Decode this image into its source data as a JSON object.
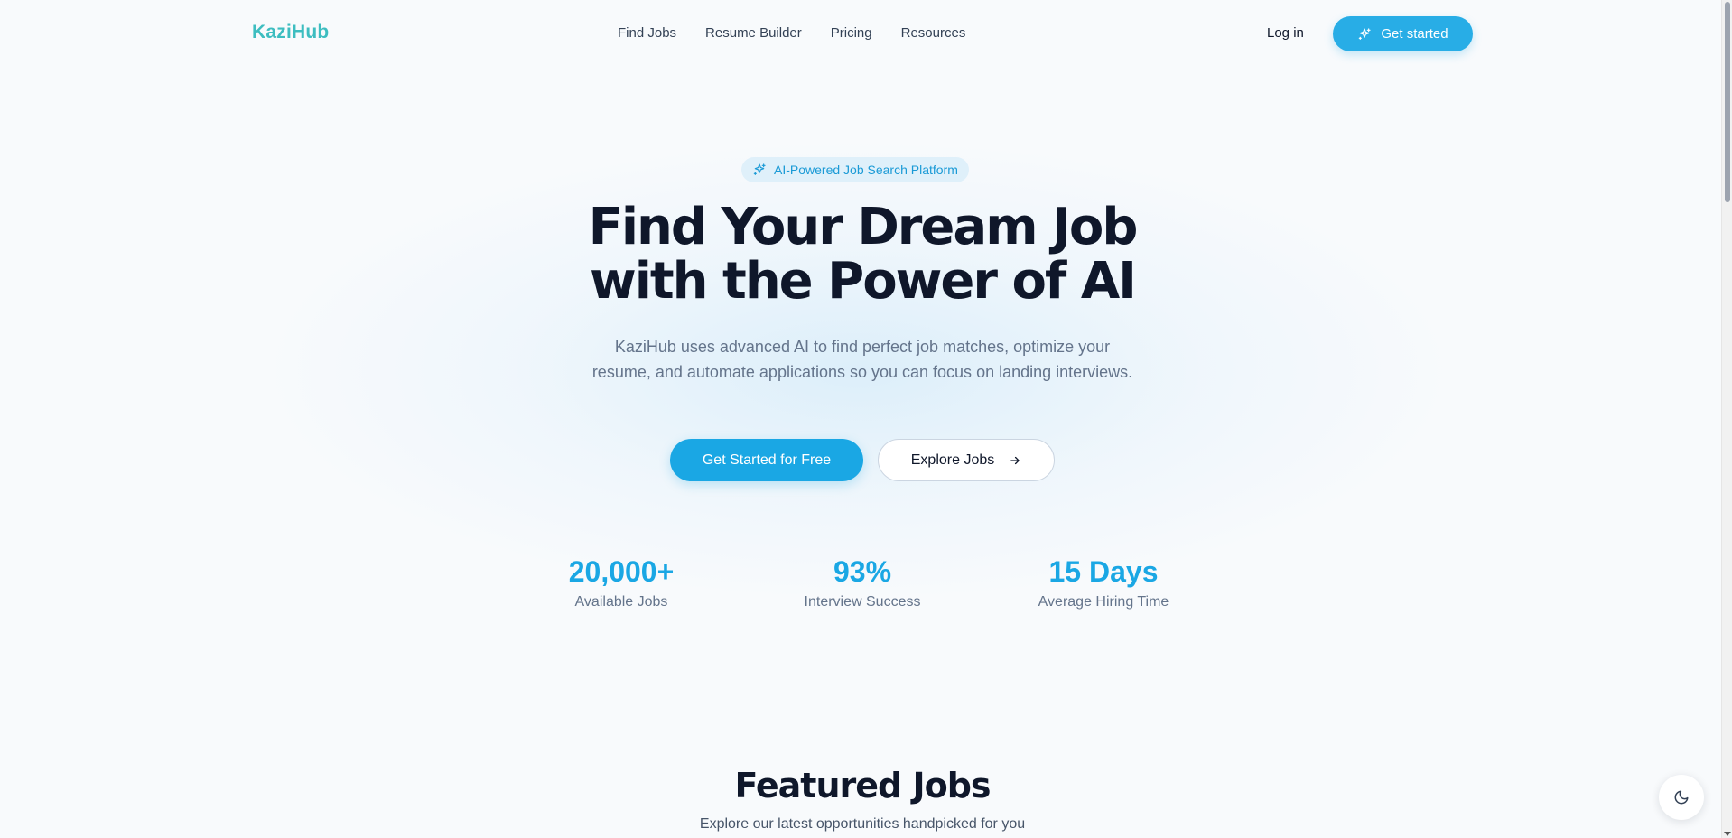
{
  "header": {
    "logo": "KaziHub",
    "nav": [
      "Find Jobs",
      "Resume Builder",
      "Pricing",
      "Resources"
    ],
    "login_label": "Log in",
    "get_started_label": "Get started"
  },
  "hero": {
    "badge": "AI-Powered Job Search Platform",
    "title_line1": "Find Your Dream Job",
    "title_line2": "with the Power of AI",
    "subtitle": "KaziHub uses advanced AI to find perfect job matches, optimize your resume, and automate applications so you can focus on landing interviews.",
    "primary_button": "Get Started for Free",
    "secondary_button": "Explore Jobs"
  },
  "stats": [
    {
      "value": "20,000+",
      "label": "Available Jobs"
    },
    {
      "value": "93%",
      "label": "Interview Success"
    },
    {
      "value": "15 Days",
      "label": "Average Hiring Time"
    }
  ],
  "featured": {
    "title": "Featured Jobs",
    "subtitle": "Explore our latest opportunities handpicked for you"
  },
  "icons": {
    "sparkle": "sparkles-icon",
    "arrow": "arrow-right-icon",
    "theme": "moon-icon"
  },
  "colors": {
    "brand": "#3dbdc0",
    "accent": "#1aa7e4",
    "heading": "#0f172a",
    "muted": "#64748b"
  }
}
